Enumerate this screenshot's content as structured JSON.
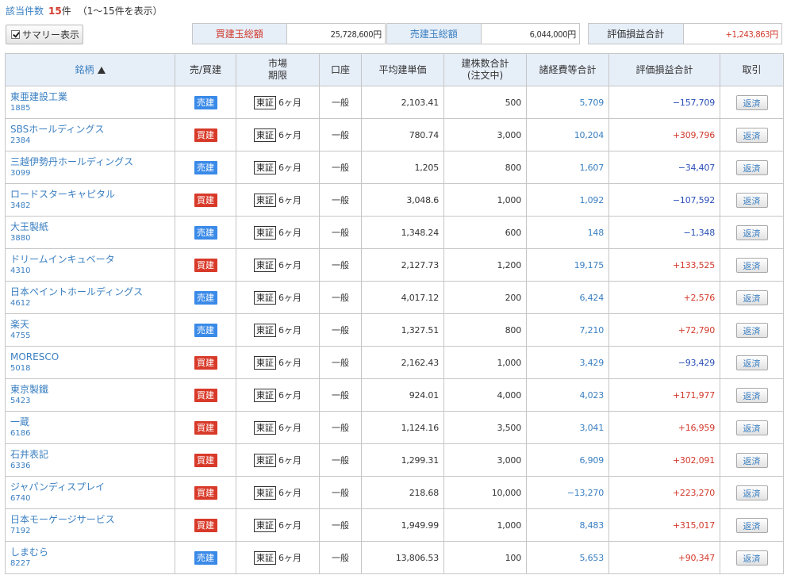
{
  "header": {
    "count_label": "該当件数",
    "count_value": "15",
    "count_unit": "件",
    "range_text": "（1〜15件を表示）",
    "summary_button": "サマリー表示"
  },
  "summary": {
    "buy_total_label": "買建玉総額",
    "buy_total_value": "25,728,600円",
    "sell_total_label": "売建玉総額",
    "sell_total_value": "6,044,000円",
    "pl_total_label": "評価損益合計",
    "pl_total_value": "+1,243,863円"
  },
  "colors": {
    "link_blue": "#3a7fc1",
    "buy_red": "#d83a2a",
    "sell_blue": "#3a8ae8",
    "negative_blue": "#2a4fb6",
    "positive_red": "#d23a2c",
    "header_bg": "#e6eef8"
  },
  "table": {
    "headers": {
      "name": "銘柄",
      "side": "売/買建",
      "market_1": "市場",
      "market_2": "期限",
      "account": "口座",
      "avg_price": "平均建単価",
      "qty_1": "建株数合計",
      "qty_2": "(注文中)",
      "fees": "諸経費等合計",
      "pl": "評価損益合計",
      "trade": "取引"
    },
    "sort_icon": "sort-up-triangle-icon",
    "rows": [
      {
        "name": "東亜建設工業",
        "code": "1885",
        "side": "売建",
        "side_type": "sell",
        "market": "東証",
        "term": "6ヶ月",
        "account": "一般",
        "avg_price": "2,103.41",
        "qty": "500",
        "fees": "5,709",
        "pl": "−157,709",
        "pl_sign": "neg",
        "action": "返済"
      },
      {
        "name": "SBSホールディングス",
        "code": "2384",
        "side": "買建",
        "side_type": "buy",
        "market": "東証",
        "term": "6ヶ月",
        "account": "一般",
        "avg_price": "780.74",
        "qty": "3,000",
        "fees": "10,204",
        "pl": "+309,796",
        "pl_sign": "pos",
        "action": "返済"
      },
      {
        "name": "三越伊勢丹ホールディングス",
        "code": "3099",
        "side": "売建",
        "side_type": "sell",
        "market": "東証",
        "term": "6ヶ月",
        "account": "一般",
        "avg_price": "1,205",
        "qty": "800",
        "fees": "1,607",
        "pl": "−34,407",
        "pl_sign": "neg",
        "action": "返済"
      },
      {
        "name": "ロードスターキャピタル",
        "code": "3482",
        "side": "買建",
        "side_type": "buy",
        "market": "東証",
        "term": "6ヶ月",
        "account": "一般",
        "avg_price": "3,048.6",
        "qty": "1,000",
        "fees": "1,092",
        "pl": "−107,592",
        "pl_sign": "neg",
        "action": "返済"
      },
      {
        "name": "大王製紙",
        "code": "3880",
        "side": "売建",
        "side_type": "sell",
        "market": "東証",
        "term": "6ヶ月",
        "account": "一般",
        "avg_price": "1,348.24",
        "qty": "600",
        "fees": "148",
        "pl": "−1,348",
        "pl_sign": "neg",
        "action": "返済"
      },
      {
        "name": "ドリームインキュベータ",
        "code": "4310",
        "side": "買建",
        "side_type": "buy",
        "market": "東証",
        "term": "6ヶ月",
        "account": "一般",
        "avg_price": "2,127.73",
        "qty": "1,200",
        "fees": "19,175",
        "pl": "+133,525",
        "pl_sign": "pos",
        "action": "返済"
      },
      {
        "name": "日本ペイントホールディングス",
        "code": "4612",
        "side": "売建",
        "side_type": "sell",
        "market": "東証",
        "term": "6ヶ月",
        "account": "一般",
        "avg_price": "4,017.12",
        "qty": "200",
        "fees": "6,424",
        "pl": "+2,576",
        "pl_sign": "pos",
        "action": "返済"
      },
      {
        "name": "楽天",
        "code": "4755",
        "side": "売建",
        "side_type": "sell",
        "market": "東証",
        "term": "6ヶ月",
        "account": "一般",
        "avg_price": "1,327.51",
        "qty": "800",
        "fees": "7,210",
        "pl": "+72,790",
        "pl_sign": "pos",
        "action": "返済"
      },
      {
        "name": "MORESCO",
        "code": "5018",
        "side": "買建",
        "side_type": "buy",
        "market": "東証",
        "term": "6ヶ月",
        "account": "一般",
        "avg_price": "2,162.43",
        "qty": "1,000",
        "fees": "3,429",
        "pl": "−93,429",
        "pl_sign": "neg",
        "action": "返済"
      },
      {
        "name": "東京製鐵",
        "code": "5423",
        "side": "買建",
        "side_type": "buy",
        "market": "東証",
        "term": "6ヶ月",
        "account": "一般",
        "avg_price": "924.01",
        "qty": "4,000",
        "fees": "4,023",
        "pl": "+171,977",
        "pl_sign": "pos",
        "action": "返済"
      },
      {
        "name": "一蔵",
        "code": "6186",
        "side": "買建",
        "side_type": "buy",
        "market": "東証",
        "term": "6ヶ月",
        "account": "一般",
        "avg_price": "1,124.16",
        "qty": "3,500",
        "fees": "3,041",
        "pl": "+16,959",
        "pl_sign": "pos",
        "action": "返済"
      },
      {
        "name": "石井表記",
        "code": "6336",
        "side": "買建",
        "side_type": "buy",
        "market": "東証",
        "term": "6ヶ月",
        "account": "一般",
        "avg_price": "1,299.31",
        "qty": "3,000",
        "fees": "6,909",
        "pl": "+302,091",
        "pl_sign": "pos",
        "action": "返済"
      },
      {
        "name": "ジャパンディスプレイ",
        "code": "6740",
        "side": "買建",
        "side_type": "buy",
        "market": "東証",
        "term": "6ヶ月",
        "account": "一般",
        "avg_price": "218.68",
        "qty": "10,000",
        "fees": "−13,270",
        "pl": "+223,270",
        "pl_sign": "pos",
        "action": "返済"
      },
      {
        "name": "日本モーゲージサービス",
        "code": "7192",
        "side": "買建",
        "side_type": "buy",
        "market": "東証",
        "term": "6ヶ月",
        "account": "一般",
        "avg_price": "1,949.99",
        "qty": "1,000",
        "fees": "8,483",
        "pl": "+315,017",
        "pl_sign": "pos",
        "action": "返済"
      },
      {
        "name": "しまむら",
        "code": "8227",
        "side": "売建",
        "side_type": "sell",
        "market": "東証",
        "term": "6ヶ月",
        "account": "一般",
        "avg_price": "13,806.53",
        "qty": "100",
        "fees": "5,653",
        "pl": "+90,347",
        "pl_sign": "pos",
        "action": "返済"
      }
    ]
  }
}
